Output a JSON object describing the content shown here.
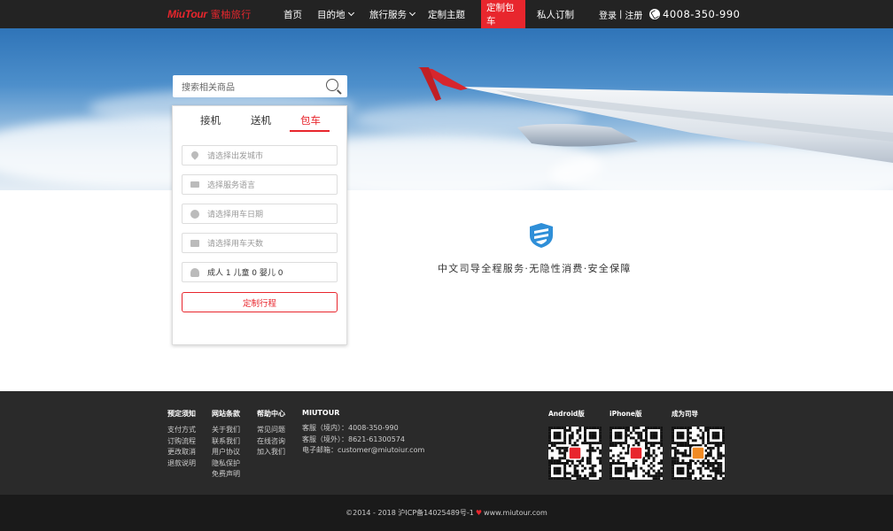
{
  "brand": {
    "logo_en": "MiuTour",
    "logo_cn": "蜜柚旅行",
    "accent_color": "#e8262d"
  },
  "nav": {
    "items": [
      {
        "label": "首页",
        "dropdown": false,
        "active": false
      },
      {
        "label": "目的地",
        "dropdown": true,
        "active": false
      },
      {
        "label": "旅行服务",
        "dropdown": true,
        "active": false
      },
      {
        "label": "定制主题",
        "dropdown": false,
        "active": false
      },
      {
        "label": "定制包车",
        "dropdown": false,
        "active": true
      },
      {
        "label": "私人订制",
        "dropdown": false,
        "active": false
      }
    ],
    "login": "登录",
    "separator": "|",
    "register": "注册",
    "phone": "4008-350-990"
  },
  "search": {
    "placeholder": "搜索相关商品"
  },
  "booking": {
    "tabs": [
      "接机",
      "送机",
      "包车"
    ],
    "active_tab": "包车",
    "fields": [
      {
        "icon": "location-pin-icon",
        "text": "请选择出发城市"
      },
      {
        "icon": "language-icon",
        "text": "选择服务语言"
      },
      {
        "icon": "clock-icon",
        "text": "请选择用车日期"
      },
      {
        "icon": "calendar-icon",
        "text": "请选择用车天数"
      },
      {
        "icon": "person-icon",
        "text": "成人 1 儿童 0 婴儿 0"
      }
    ],
    "submit": "定制行程"
  },
  "guarantee": {
    "text": "中文司导全程服务·无隐性消费·安全保障"
  },
  "footer": {
    "columns": [
      {
        "title": "预定须知",
        "links": [
          "支付方式",
          "订购流程",
          "更改取消",
          "退款说明"
        ]
      },
      {
        "title": "网站条款",
        "links": [
          "关于我们",
          "联系我们",
          "用户协议",
          "隐私保护",
          "免费声明"
        ]
      },
      {
        "title": "帮助中心",
        "links": [
          "常见问题",
          "在线咨询",
          "加入我们"
        ]
      },
      {
        "title": "MIUTOUR",
        "links": [
          "客服（境内）：4008-350-990",
          "客服（境外）：8621-61300574",
          "电子邮箱：customer@miutoiur.com"
        ]
      }
    ],
    "qr_codes": [
      {
        "label": "Android版"
      },
      {
        "label": "iPhone版"
      },
      {
        "label": "成为司导"
      }
    ],
    "copyright_left": "©2014 - 2018 沪ICP备14025489号-1",
    "copyright_right": "www.miutour.com"
  }
}
